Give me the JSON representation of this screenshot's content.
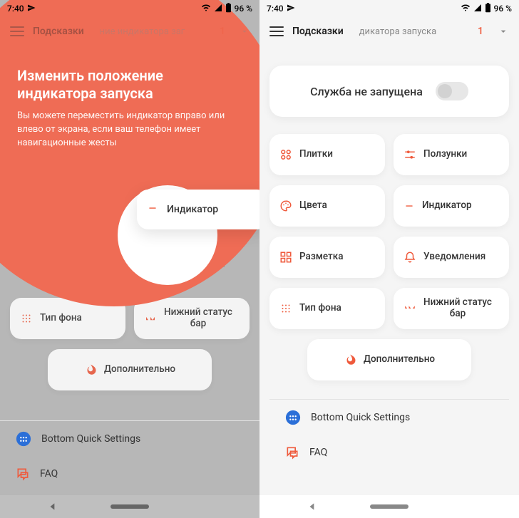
{
  "status": {
    "time": "7:40",
    "battery": "96 %"
  },
  "header": {
    "title": "Подсказки",
    "left_sub": "ние индикатора заг",
    "right_sub": "дикатора запуска",
    "count": "1"
  },
  "service": {
    "text": "Служба не запущена"
  },
  "coach": {
    "title_l1": "Изменить положение",
    "title_l2": "индикатора запуска",
    "body": "Вы можете переместить индикатор вправо или влево от экрана, если ваш телефон имеет навигационные жесты"
  },
  "tiles": {
    "tiles": "Плитки",
    "sliders": "Ползунки",
    "colors": "Цвета",
    "indicator": "Индикатор",
    "layout": "Разметка",
    "notifications": "Уведомления",
    "bgtype": "Тип фона",
    "bottom_status_l1": "Нижний статус",
    "bottom_status_l2": "бар",
    "more": "Дополнительно"
  },
  "ghost": {
    "tiles": "Плитки",
    "sliders": "Ползунки",
    "colors": "Цвета",
    "layout": "Разметка",
    "notifications": "Уведомления",
    "bgtype": "Тип фона",
    "bottom_status_l1": "Нижний статус",
    "bottom_status_l2": "бар",
    "more": "Дополнительно",
    "service": "ена"
  },
  "footer": {
    "bqs": "Bottom Quick Settings",
    "faq": "FAQ"
  }
}
